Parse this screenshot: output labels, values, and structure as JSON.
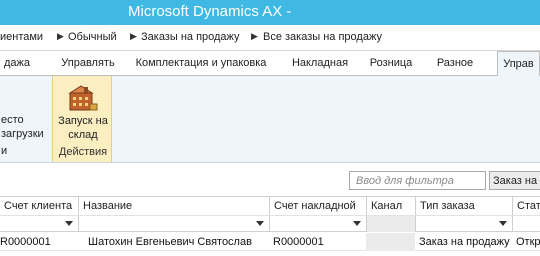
{
  "window": {
    "title": "Microsoft Dynamics AX -"
  },
  "breadcrumb": {
    "items": [
      "иентами",
      "Обычный",
      "Заказы на продажу",
      "Все заказы на продажу"
    ]
  },
  "ribbon_tabs": [
    "дажа",
    "Управлять",
    "Комплектация и упаковка",
    "Накладная",
    "Розница",
    "Разное",
    "Управ"
  ],
  "ribbon": {
    "left_group_lines": [
      "есто",
      "загрузки",
      "и"
    ],
    "launch_button": {
      "line1": "Запуск на",
      "line2": "склад",
      "icon": "warehouse-building-icon"
    },
    "actions_group_label": "Действия"
  },
  "filter": {
    "placeholder": "Ввод для фильтра",
    "field": "Заказ на"
  },
  "grid": {
    "columns": [
      "Счет клиента",
      "Название",
      "Счет накладной",
      "Канал",
      "Тип заказа",
      "Стат"
    ],
    "rows": [
      {
        "account": "R0000001",
        "name": "Шатохин Евгеньевич Святослав",
        "invoice_account": "R0000001",
        "channel": "",
        "order_type": "Заказ на продажу",
        "status": "Откр"
      }
    ]
  },
  "colors": {
    "titlebar": "#3fb9e3",
    "ribbon_bg": "#eef5fb",
    "action_group_bg": "#fbeec1"
  }
}
